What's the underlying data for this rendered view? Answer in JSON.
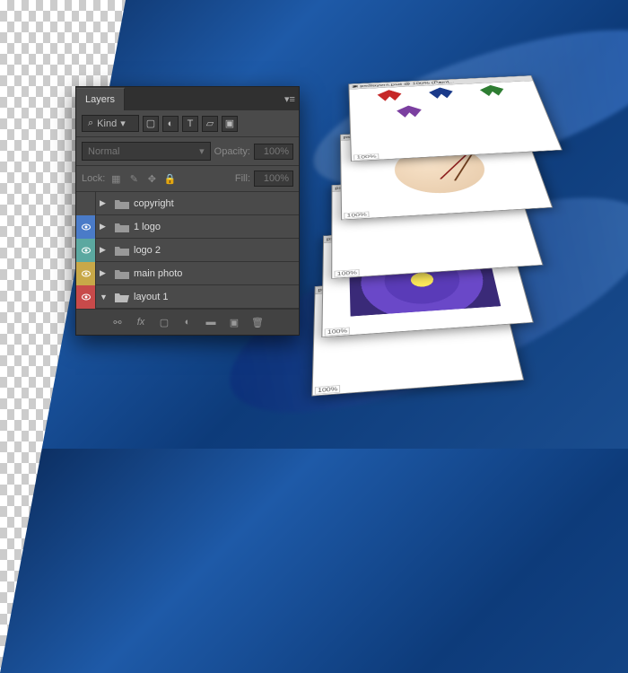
{
  "panel": {
    "tab_label": "Layers",
    "kind_label": "Kind",
    "kind_search_glyph": "⌕",
    "blend_mode": "Normal",
    "opacity_label": "Opacity:",
    "opacity_value": "100%",
    "lock_label": "Lock:",
    "fill_label": "Fill:",
    "fill_value": "100%",
    "layers": [
      {
        "name": "copyright",
        "vis_color": "none",
        "expanded": false
      },
      {
        "name": "1 logo",
        "vis_color": "blue",
        "expanded": false
      },
      {
        "name": "logo 2",
        "vis_color": "aqua",
        "expanded": false
      },
      {
        "name": "main photo",
        "vis_color": "yellow",
        "expanded": false
      },
      {
        "name": "layout 1",
        "vis_color": "red",
        "expanded": true
      }
    ]
  },
  "stack": {
    "titles": [
      "psdlayers.psd @ 100% (Paint...",
      "psdlayers.psd @ 100% ...",
      "psdlayers.psd @ 100% ...",
      "psdlayers.psd @ 100% ...",
      "psdlayers.psd @ 100% ..."
    ],
    "zoom": "100%"
  }
}
